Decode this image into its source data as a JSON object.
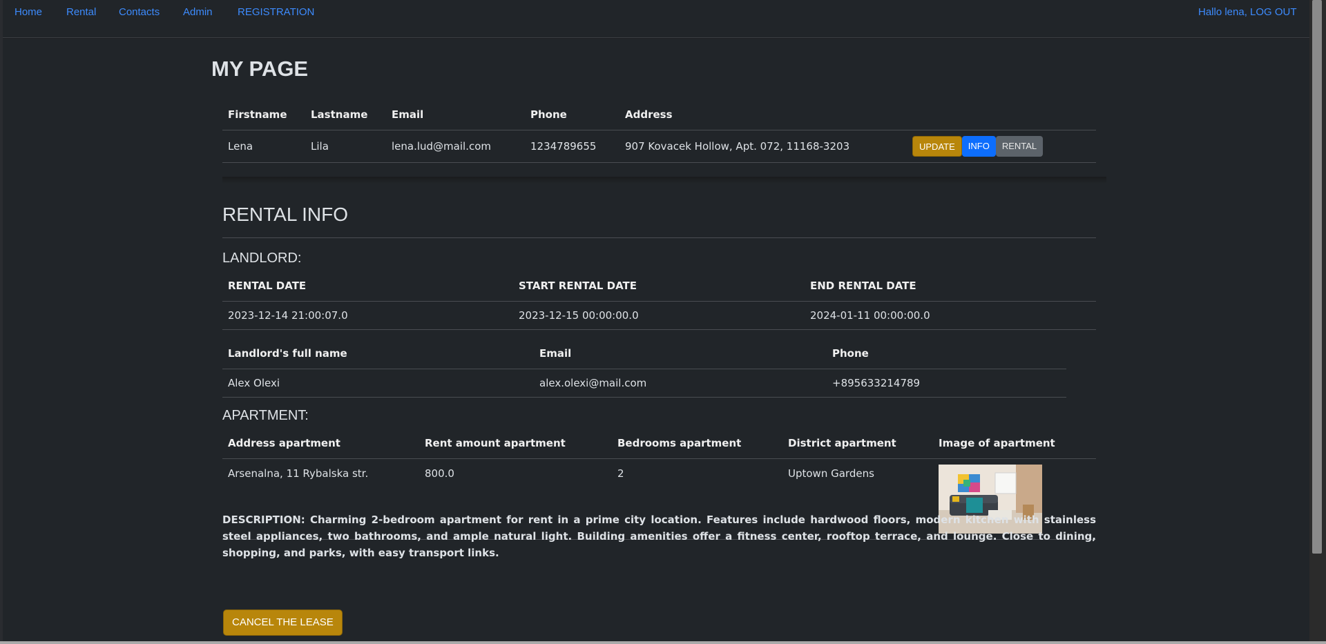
{
  "nav": {
    "home": "Home",
    "rental": "Rental",
    "contacts": "Contacts",
    "admin": "Admin",
    "registration": "REGISTRATION",
    "greeting": "Hallo lena, LOG OUT"
  },
  "page_title": "MY PAGE",
  "user_table": {
    "headers": [
      "Firstname",
      "Lastname",
      "Email",
      "Phone",
      "Address"
    ],
    "row": [
      "Lena",
      "Lila",
      "lena.lud@mail.com",
      "1234789655",
      "907 Kovacek Hollow, Apt. 072, 11168-3203"
    ],
    "buttons": {
      "update": "UPDATE",
      "info": "INFO",
      "rental": "RENTAL"
    }
  },
  "rental_info": {
    "title": "RENTAL INFO",
    "landlord_label": "LANDLORD:",
    "dates": {
      "headers": [
        "RENTAL DATE",
        "START RENTAL DATE",
        "END RENTAL DATE"
      ],
      "row": [
        "2023-12-14 21:00:07.0",
        "2023-12-15 00:00:00.0",
        "2024-01-11 00:00:00.0"
      ]
    },
    "landlord": {
      "headers": [
        "Landlord's full name",
        "Email",
        "Phone"
      ],
      "row": [
        "Alex Olexi",
        "alex.olexi@mail.com",
        "+895633214789"
      ]
    },
    "apartment_label": "APARTMENT:",
    "apartment": {
      "headers": [
        "Address apartment",
        "Rent amount apartment",
        "Bedrooms apartment",
        "District apartment",
        "Image of apartment"
      ],
      "row": [
        "Arsenalna, 11 Rybalska str.",
        "800.0",
        "2",
        "Uptown Gardens"
      ]
    },
    "description": "DESCRIPTION: Charming 2-bedroom apartment for rent in a prime city location. Features include hardwood floors, modern kitchen with stainless steel appliances, two bathrooms, and ample natural light. Building amenities offer a fitness center, rooftop terrace, and lounge. Close to dining, shopping, and parks, with easy transport links.",
    "cancel_button": "CANCEL THE LEASE"
  }
}
